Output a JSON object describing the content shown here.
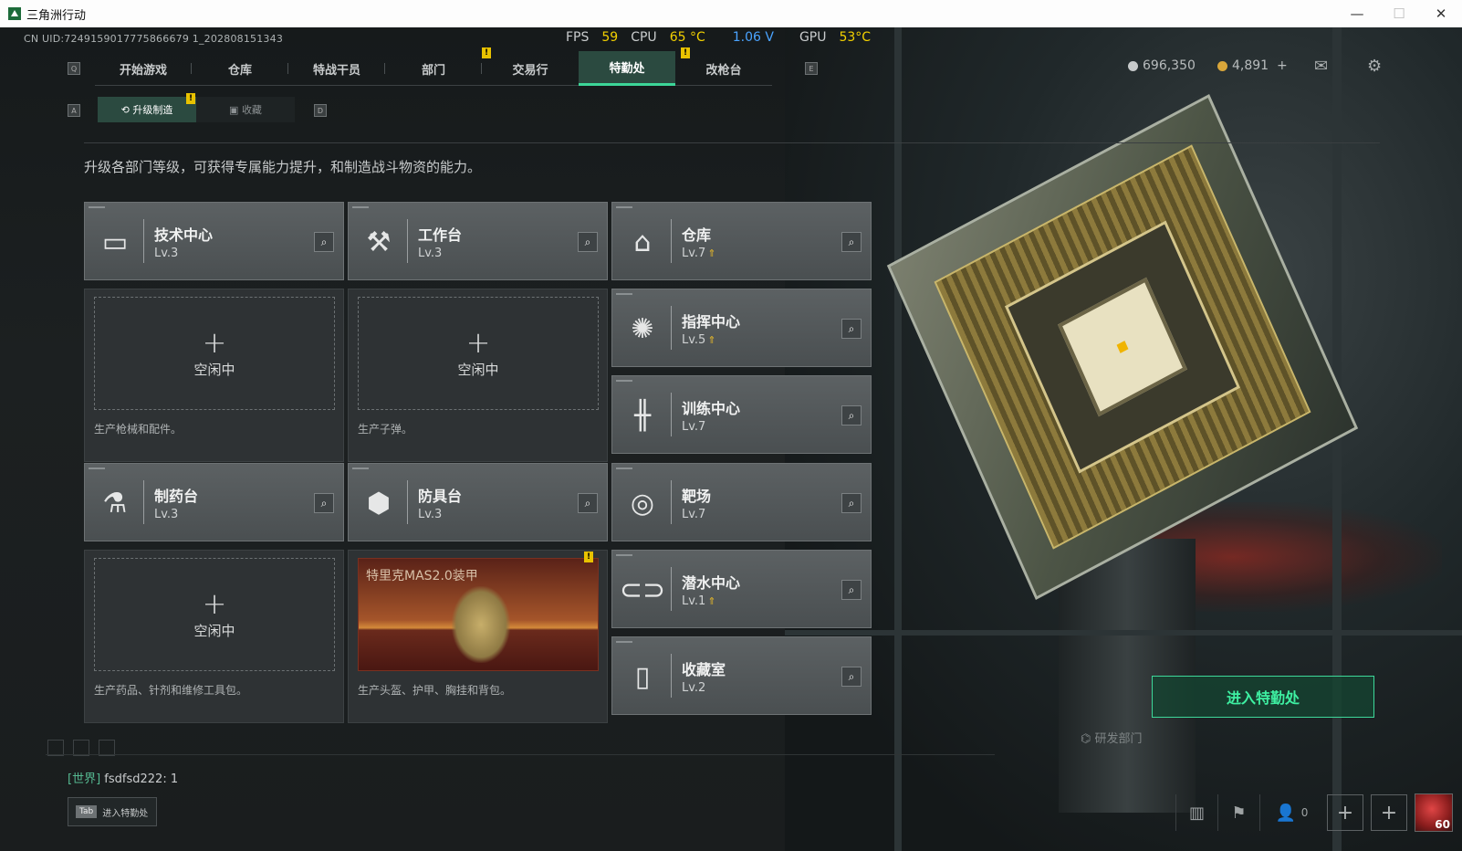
{
  "window": {
    "title": "三角洲行动",
    "minimize": "—",
    "maximize": "☐",
    "close": "✕"
  },
  "uid": "CN UID:7249159017775866679 1_202808151343",
  "perf": {
    "fps_label": "FPS",
    "fps": "59",
    "cpu_label": "CPU",
    "cpu_temp": "65 °C",
    "voltage": "1.06 V",
    "gpu_label": "GPU",
    "gpu_temp": "53°C"
  },
  "nav": {
    "q": "Q",
    "e": "E",
    "tabs": [
      "开始游戏",
      "仓库",
      "特战干员",
      "部门",
      "交易行",
      "特勤处",
      "改枪台"
    ],
    "active": "特勤处",
    "notif": "!"
  },
  "currency": {
    "silver": "696,350",
    "gold": "4,891",
    "plus": "+"
  },
  "subnav": {
    "a": "A",
    "d": "D",
    "tabs": [
      "升级制造",
      "收藏"
    ],
    "active": "升级制造"
  },
  "description": "升级各部门等级，可获得专属能力提升，和制造战斗物资的能力。",
  "departments": {
    "tech": {
      "name": "技术中心",
      "level": "Lv.3",
      "icon": "monitor-icon"
    },
    "workbench": {
      "name": "工作台",
      "level": "Lv.3",
      "icon": "tools-icon"
    },
    "warehouse": {
      "name": "仓库",
      "level": "Lv.7",
      "icon": "garage-icon",
      "upgradable": true
    },
    "command": {
      "name": "指挥中心",
      "level": "Lv.5",
      "icon": "command-icon",
      "upgradable": true
    },
    "training": {
      "name": "训练中心",
      "level": "Lv.7",
      "icon": "dumbbell-icon"
    },
    "pharmacy": {
      "name": "制药台",
      "level": "Lv.3",
      "icon": "microscope-icon"
    },
    "armory": {
      "name": "防具台",
      "level": "Lv.3",
      "icon": "cubes-icon"
    },
    "range": {
      "name": "靶场",
      "level": "Lv.7",
      "icon": "target-icon"
    },
    "diving": {
      "name": "潜水中心",
      "level": "Lv.1",
      "icon": "goggles-icon",
      "upgradable": true
    },
    "collection": {
      "name": "收藏室",
      "level": "Lv.2",
      "icon": "vault-icon"
    }
  },
  "slots": {
    "tech": {
      "idle": "空闲中",
      "desc": "生产枪械和配件。"
    },
    "workbench": {
      "idle": "空闲中",
      "desc": "生产子弹。"
    },
    "pharmacy": {
      "idle": "空闲中",
      "desc": "生产药品、针剂和维修工具包。"
    },
    "armory": {
      "crafting": "特里克MAS2.0装甲",
      "desc": "生产头盔、护甲、胸挂和背包。"
    }
  },
  "enter_button": "进入特勤处",
  "scene_label": "研发部门",
  "chat": {
    "channel": "[世界]",
    "message": "fsdfsd222: 1"
  },
  "tab_hint": {
    "key": "Tab",
    "label": "进入特勤处"
  },
  "bottom": {
    "friends": "0",
    "player_level": "60"
  },
  "colors": {
    "accent": "#3cd698",
    "warning": "#e8c200",
    "upgrade": "#e3b62a"
  }
}
